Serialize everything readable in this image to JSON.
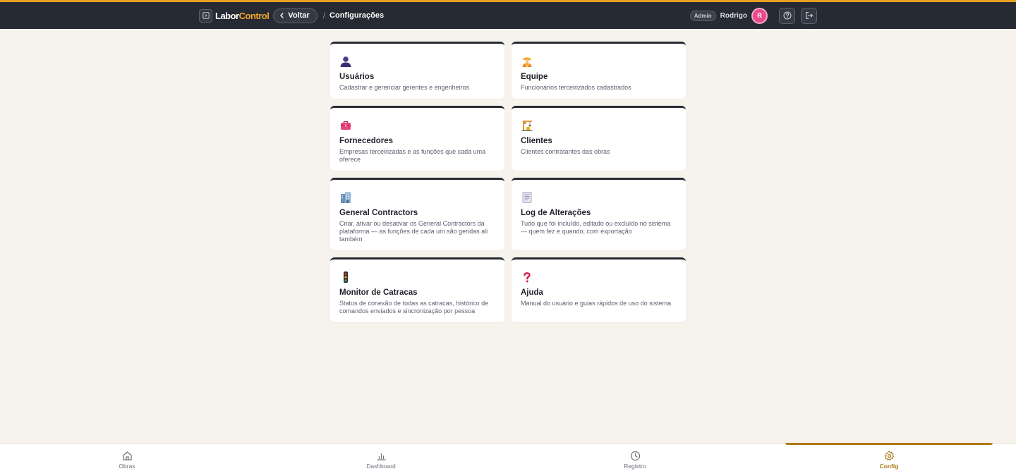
{
  "header": {
    "brand_part1": "Labor",
    "brand_part2": "Control",
    "back_label": "Voltar",
    "breadcrumb_separator": "/",
    "page_title": "Configurações",
    "role_badge": "Admin",
    "user_name": "Rodrigo",
    "avatar_initial": "R"
  },
  "cards": [
    {
      "title": "Usuários",
      "desc": "Cadastrar e gerenciar gerentes e engenheiros",
      "icon": "user-icon"
    },
    {
      "title": "Equipe",
      "desc": "Funcionários terceirizados cadastrados",
      "icon": "worker-icon"
    },
    {
      "title": "Fornecedores",
      "desc": "Empresas terceirizadas e as funções que cada uma oferece",
      "icon": "toolbox-icon"
    },
    {
      "title": "Clientes",
      "desc": "Clientes contratantes das obras",
      "icon": "crane-icon"
    },
    {
      "title": "General Contractors",
      "desc": "Criar, ativar ou desativar os General Contractors da plataforma — as funções de cada um são geridas ali também",
      "icon": "building-icon"
    },
    {
      "title": "Log de Alterações",
      "desc": "Tudo que foi incluído, editado ou excluído no sistema — quem fez e quando, com exportação",
      "icon": "document-icon"
    },
    {
      "title": "Monitor de Catracas",
      "desc": "Status de conexão de todas as catracas, histórico de comandos enviados e sincronização por pessoa",
      "icon": "traffic-light-icon"
    },
    {
      "title": "Ajuda",
      "desc": "Manual do usuário e guias rápidos de uso do sistema",
      "icon": "question-icon"
    }
  ],
  "bottom_nav": [
    {
      "label": "Obras",
      "icon": "home-icon"
    },
    {
      "label": "Dashboard",
      "icon": "bar-chart-icon"
    },
    {
      "label": "Registro",
      "icon": "clock-icon"
    },
    {
      "label": "Config",
      "icon": "gear-icon",
      "active": true
    }
  ],
  "colors": {
    "accent": "#e9a020",
    "header_bg": "#262a33",
    "page_bg": "#f6f3ec",
    "active_nav": "#b07a16",
    "avatar": "#e54a8d"
  }
}
